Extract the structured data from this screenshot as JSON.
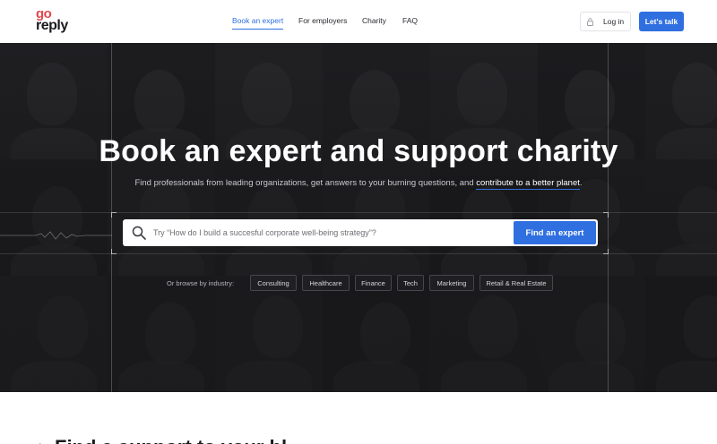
{
  "header": {
    "logo_top": "go",
    "logo_bottom": "reply",
    "nav": [
      {
        "label": "Book an expert",
        "active": true
      },
      {
        "label": "For employers",
        "active": false
      },
      {
        "label": "Charity",
        "active": false
      },
      {
        "label": "FAQ",
        "active": false
      }
    ],
    "login_label": "Log in",
    "cta_label": "Let's talk"
  },
  "hero": {
    "title": "Book an expert and support charity",
    "subtitle_prefix": "Find professionals from leading organizations, get answers to your burning questions, and ",
    "subtitle_link": "contribute to a better planet",
    "subtitle_suffix": ".",
    "search": {
      "placeholder": "Try “How do I build a succesful corporate well-being strategy”?",
      "value": "",
      "button_label": "Find an expert"
    },
    "browse": {
      "label": "Or browse by industry:",
      "industries": [
        "Consulting",
        "Healthcare",
        "Finance",
        "Tech",
        "Marketing",
        "Retail & Real Estate"
      ]
    }
  },
  "below": {
    "title": "Find a support to your bl..."
  },
  "colors": {
    "accent": "#2f6fe0",
    "logo_red": "#e0474c",
    "hero_bg": "#1d1d20"
  }
}
